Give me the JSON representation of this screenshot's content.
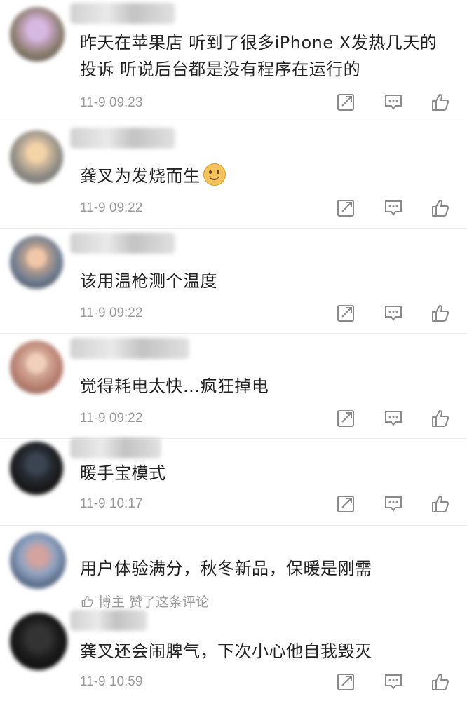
{
  "comments": [
    {
      "text": "昨天在苹果店 听到了很多iPhone X发热几天的投诉 听说后台都是没有程序在运行的",
      "timestamp": "11-9 09:23"
    },
    {
      "text": "龚叉为发烧而生",
      "emoji": "smile-emoji",
      "timestamp": "11-9 09:22"
    },
    {
      "text": "该用温枪测个温度",
      "timestamp": "11-9 09:22"
    },
    {
      "text": "觉得耗电太快...疯狂掉电",
      "timestamp": "11-9 09:22"
    },
    {
      "text": "暖手宝模式",
      "timestamp": "11-9 10:17"
    },
    {
      "text": "用户体验满分，秋冬新品，保暖是刚需",
      "liked_by_author": {
        "author_label": "博主",
        "action_label": "赞了这条评论"
      }
    },
    {
      "text": "龚叉还会闹脾气，下次小心他自我毁灭",
      "timestamp": "11-9 10:59"
    }
  ],
  "icons": {
    "share": "share-icon",
    "reply": "reply-icon",
    "like": "thumbs-up-icon"
  },
  "colors": {
    "text": "#222222",
    "meta": "#9a9a9a",
    "icon": "#8a8a8a",
    "divider": "#ececec"
  }
}
